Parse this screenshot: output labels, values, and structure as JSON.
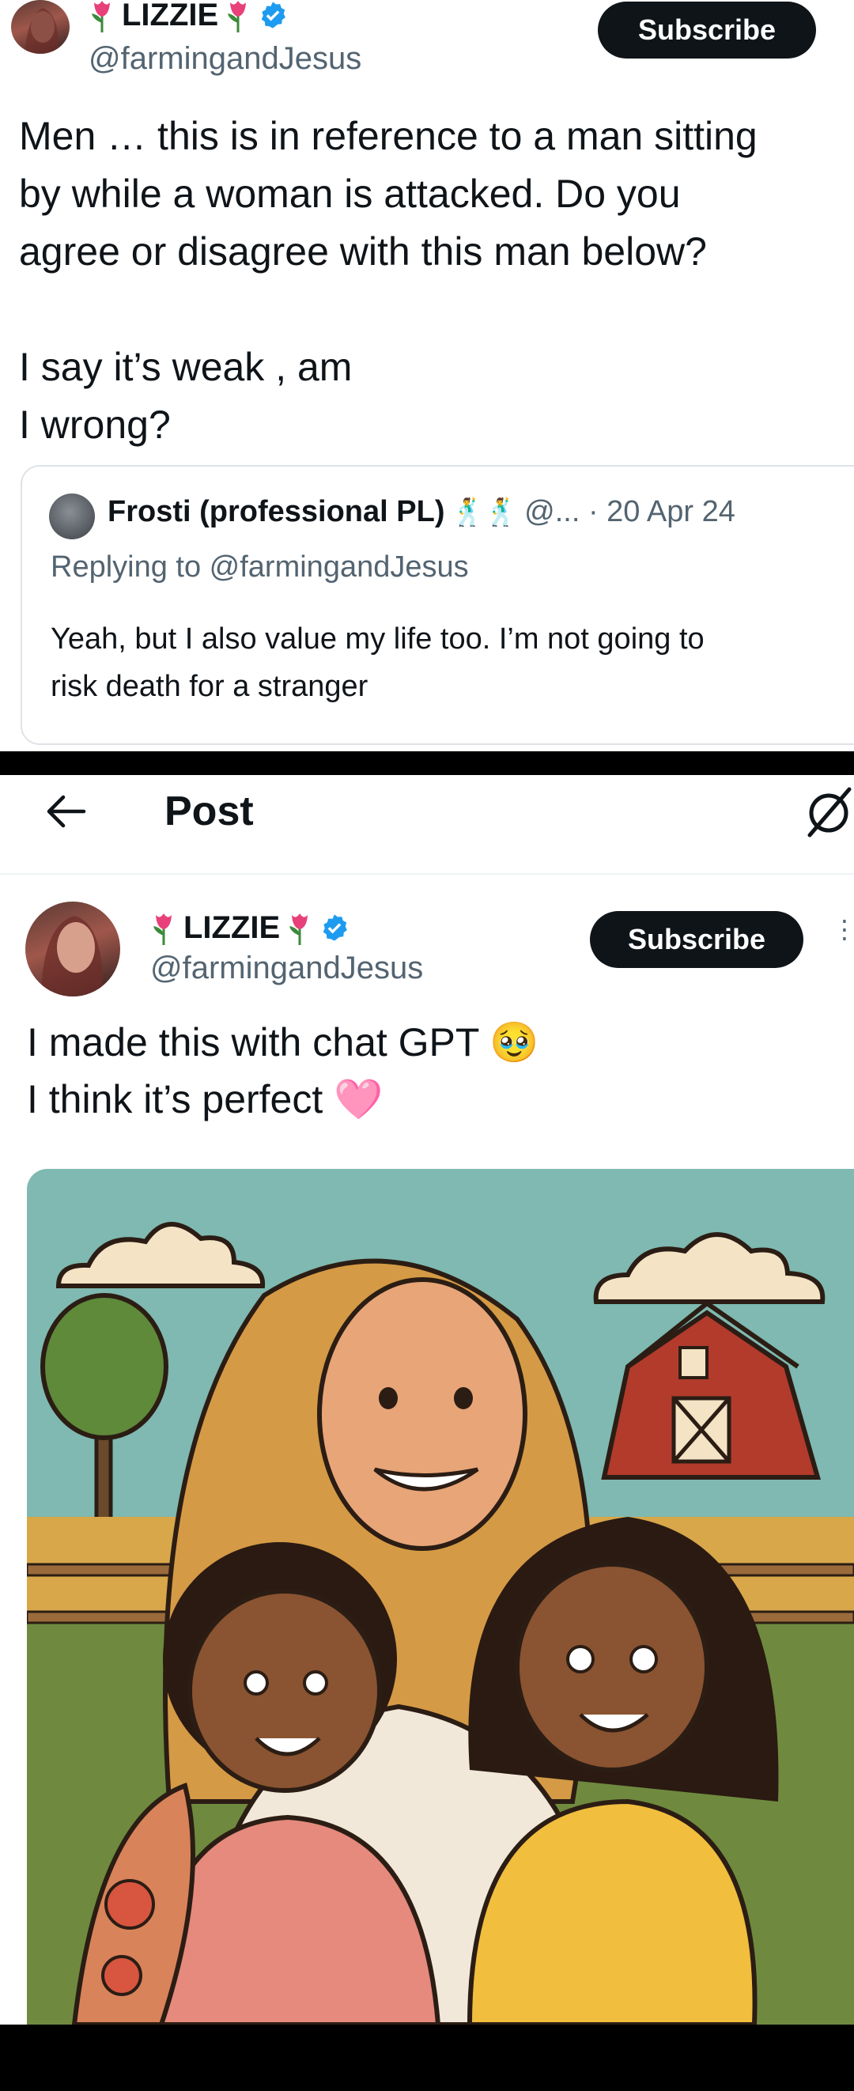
{
  "top_post": {
    "display_name": "LIZZIE",
    "handle": "@farmingandJesus",
    "subscribe_label": "Subscribe",
    "text": "Men … this is in reference to a man sitting\nby while a woman is attacked. Do you\nagree or disagree with this man below?\n\nI say it’s weak , am\nI wrong?",
    "quote": {
      "display_name": "Frosti (professional PL)",
      "handle_date": "@... · 20 Apr 24",
      "replying_to": "Replying to @farmingandJesus",
      "text": "Yeah, but I also value my life too. I’m not going to\nrisk death for a stranger"
    }
  },
  "header": {
    "title": "Post",
    "back_icon": "back-arrow-icon",
    "grok_icon": "grok-icon"
  },
  "main_post": {
    "display_name": "LIZZIE",
    "handle": "@farmingandJesus",
    "subscribe_label": "Subscribe",
    "text_line1": "I made this with chat GPT 🥹",
    "text_line2": "I think it’s perfect 🩷",
    "image": "illustration of a smiling woman with two children on a farm"
  },
  "colors": {
    "verified": "#1d9bf0",
    "text": "#0f1419",
    "secondary": "#536471",
    "sky": "#7fb9b1"
  }
}
